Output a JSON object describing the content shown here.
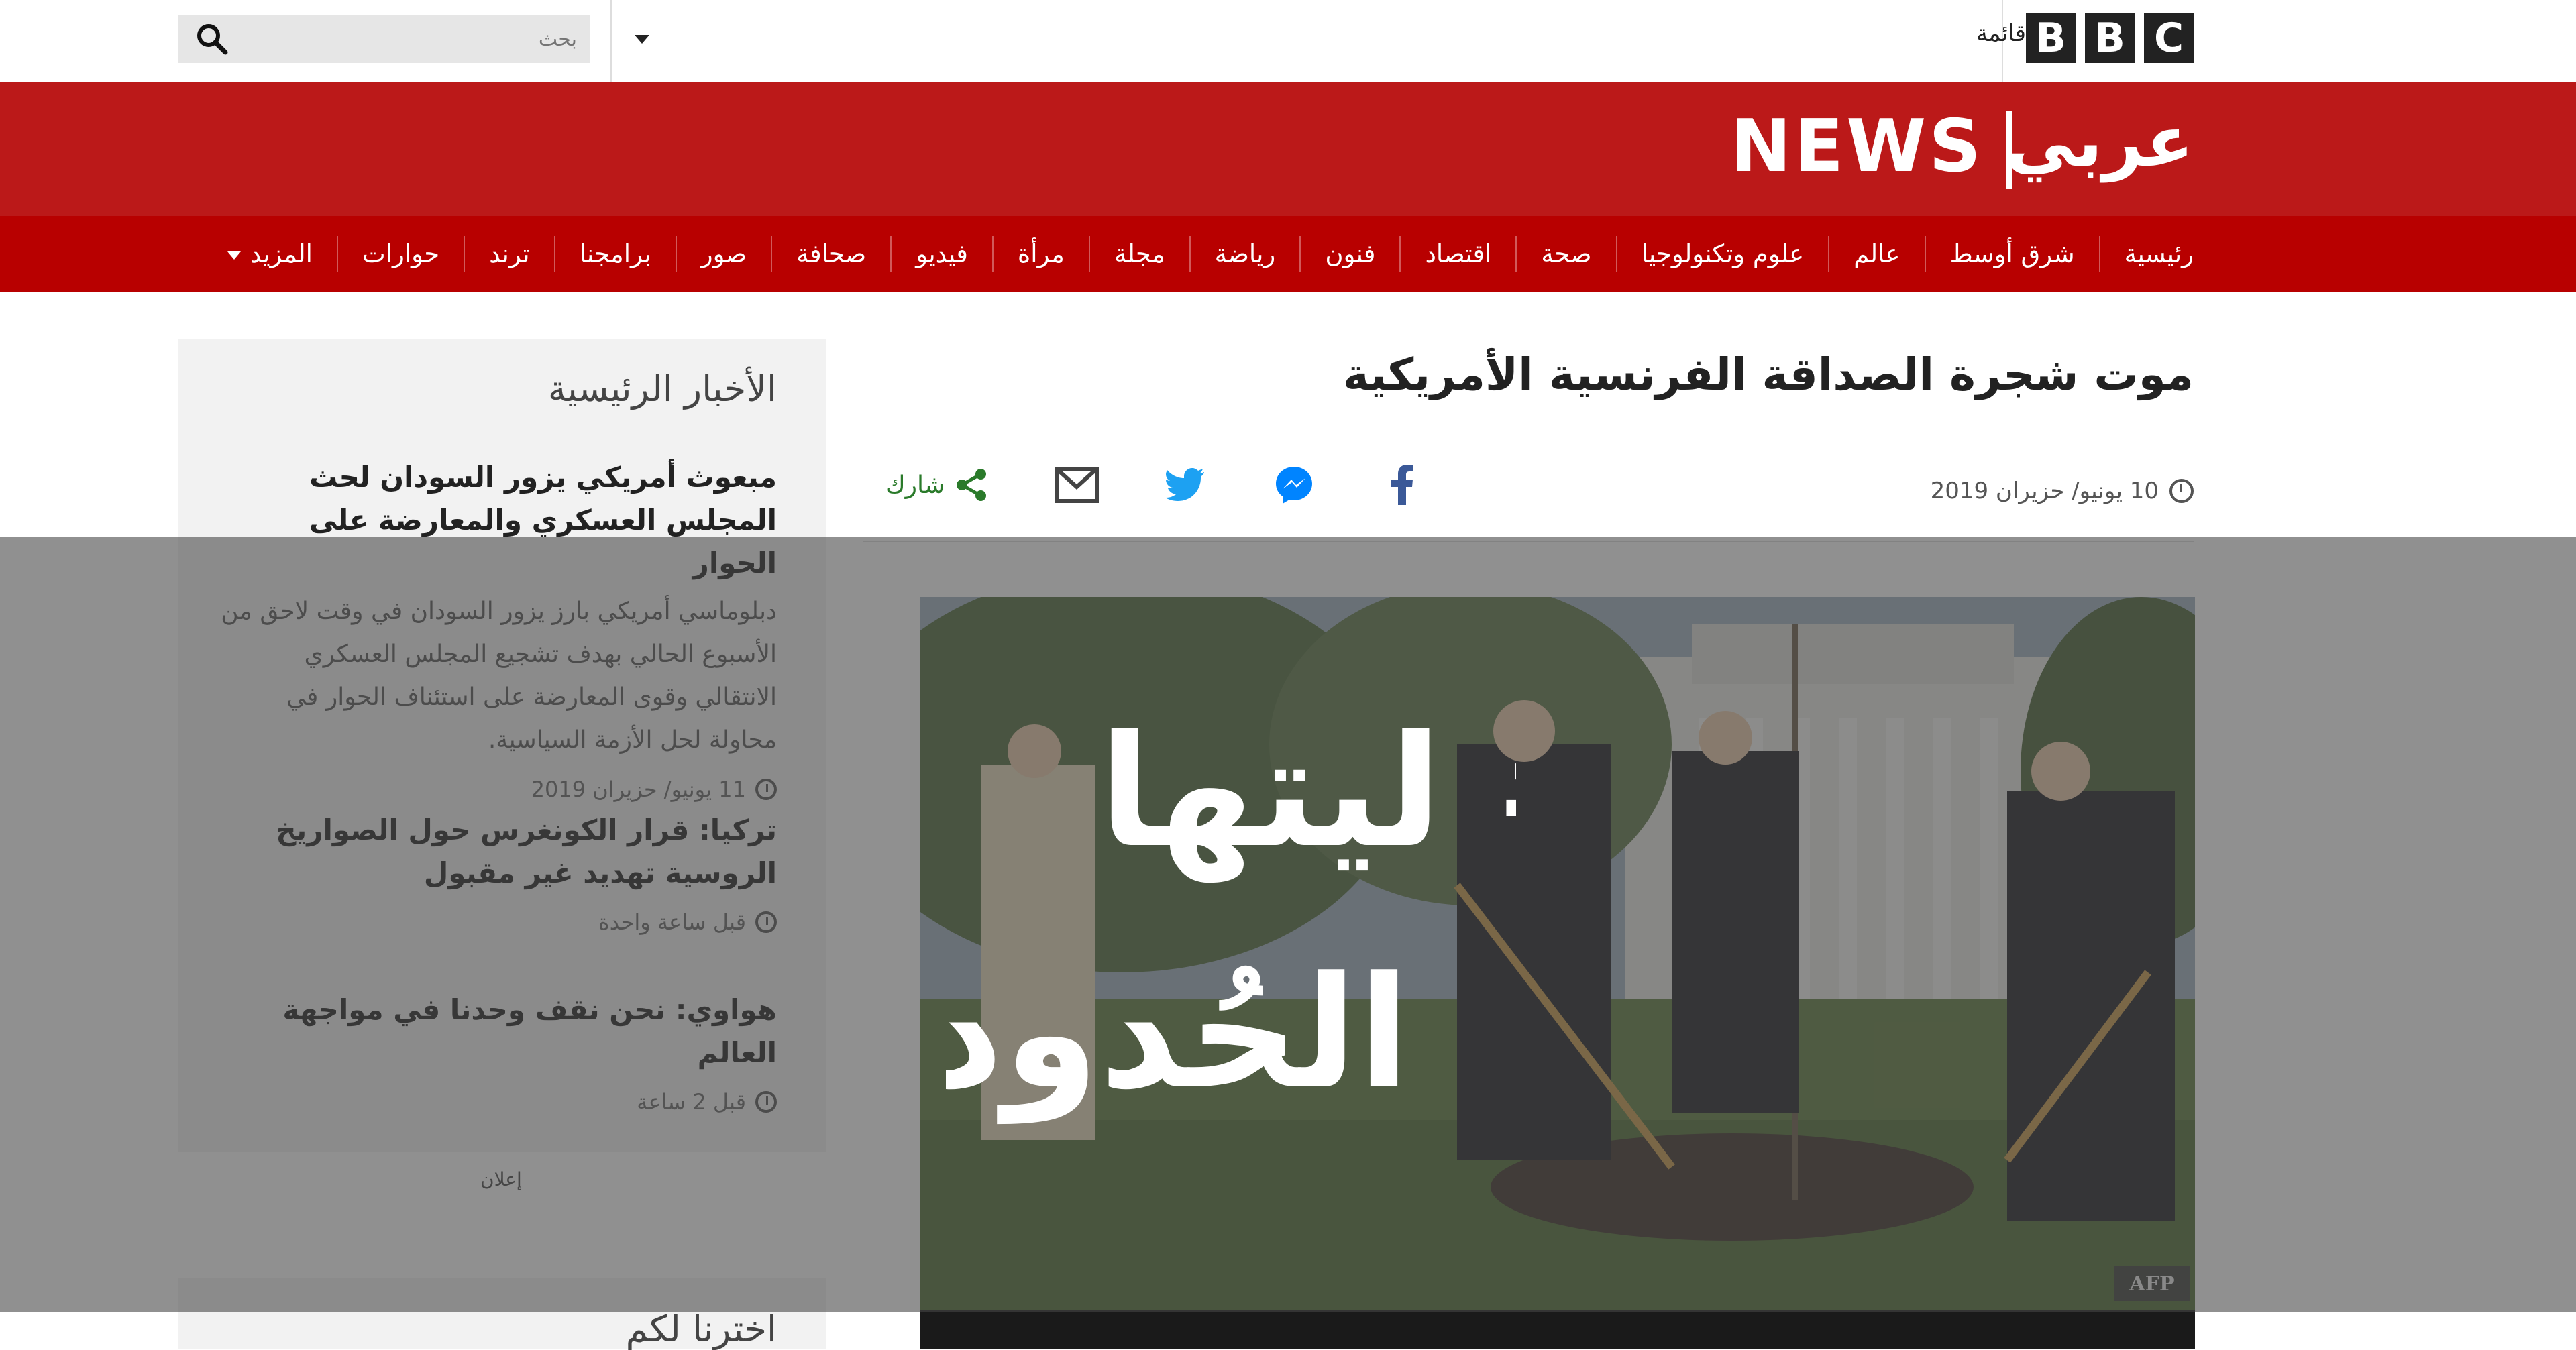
{
  "topbar": {
    "logo_letters": [
      "B",
      "B",
      "C"
    ],
    "menu_label": "قائمة",
    "search_placeholder": "بحث"
  },
  "brand": {
    "news": "NEWS",
    "arabic": "عربي",
    "bar_color": "#bb1919",
    "nav_color": "#b80000"
  },
  "nav": {
    "items": [
      "رئيسية",
      "شرق أوسط",
      "عالم",
      "علوم وتكنولوجيا",
      "صحة",
      "اقتصاد",
      "فنون",
      "رياضة",
      "مجلة",
      "مرأة",
      "فيديو",
      "صحافة",
      "صور",
      "برامجنا",
      "ترند",
      "حوارات"
    ],
    "more": "المزيد"
  },
  "article": {
    "headline": "موت شجرة الصداقة الفرنسية الأمريكية",
    "date": "10 يونيو/ حزيران 2019",
    "share_label": "شارك",
    "image_credit": "AFP"
  },
  "share_icons": [
    "facebook-icon",
    "messenger-icon",
    "twitter-icon",
    "email-icon",
    "share-icon"
  ],
  "sidebar": {
    "title": "الأخبار الرئيسية",
    "stories": [
      {
        "headline": "مبعوث أمريكي يزور السودان لحث المجلس العسكري والمعارضة على الحوار",
        "summary": "دبلوماسي أمريكي بارز يزور السودان في وقت لاحق من الأسبوع الحالي بهدف تشجيع المجلس العسكري الانتقالي وقوى المعارضة على استئناف الحوار في محاولة لحل الأزمة السياسية.",
        "time": "11 يونيو/ حزيران 2019"
      },
      {
        "headline": "تركيا: قرار الكونغرس حول الصواريخ الروسية تهديد غير مقبول",
        "time": "قبل ساعة واحدة"
      },
      {
        "headline": "هواوي: نحن نقف وحدنا في مواجهة العالم",
        "time": "قبل 2 ساعة"
      }
    ],
    "ad_label": "إعلان",
    "second_title": "اخترنا لكم"
  },
  "overlay": {
    "line1": "# ليتها",
    "line2": "الحُدود"
  }
}
